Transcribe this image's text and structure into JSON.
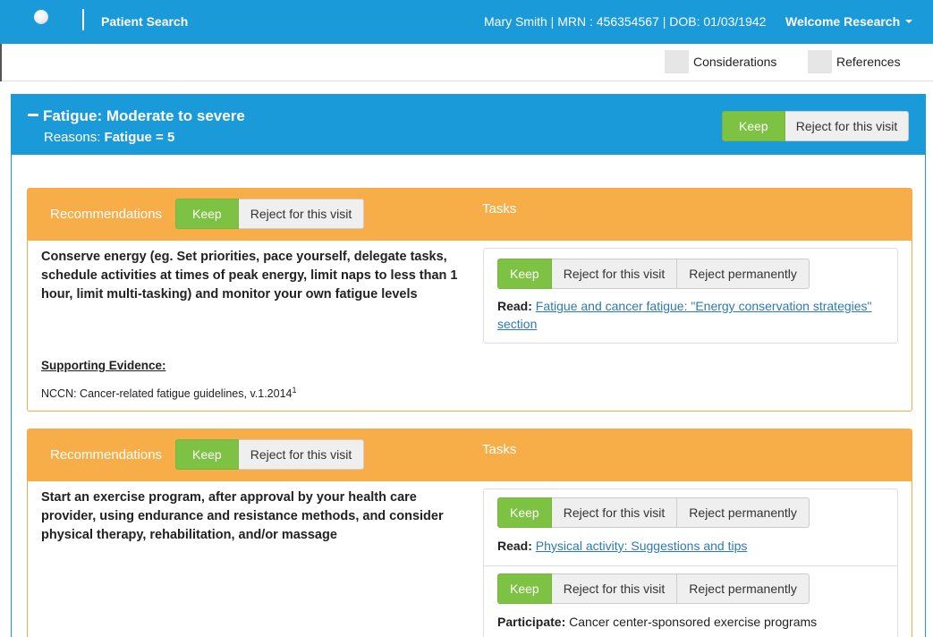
{
  "header": {
    "logo_icon": "logo-icon",
    "nav_title": "Patient Search",
    "patient_info": "Mary Smith | MRN : 456354567 | DOB: 01/03/1942",
    "user_menu": "Welcome Research",
    "user_menu_icon": "caret-down-icon",
    "brand_color": "#1a9ad9"
  },
  "subnav": {
    "considerations": "Considerations",
    "references": "References"
  },
  "panel": {
    "title": "Fatigue: Moderate to severe",
    "reasons_label": "Reasons:",
    "reasons_value": "Fatigue = 5",
    "keep": "Keep",
    "reject_visit": "Reject for this visit"
  },
  "cards": [
    {
      "recommendations_label": "Recommendations",
      "keep": "Keep",
      "reject_visit": "Reject for this visit",
      "tasks_label": "Tasks",
      "recommendation": "Conserve energy (eg. Set priorities, pace yourself, delegate tasks, schedule activities at times of peak energy, limit naps to less than 1 hour, limit multi-tasking) and monitor your own fatigue levels",
      "evidence_title": "Supporting Evidence:",
      "evidence_text": "NCCN: Cancer-related fatigue guidelines, v.1.2014",
      "evidence_sup": "1",
      "tasks": [
        {
          "keep": "Keep",
          "reject_visit": "Reject for this visit",
          "reject_perm": "Reject permanently",
          "action": "Read:",
          "link": "Fatigue and cancer fatigue: \"Energy conservation strategies\" section"
        }
      ]
    },
    {
      "recommendations_label": "Recommendations",
      "keep": "Keep",
      "reject_visit": "Reject for this visit",
      "tasks_label": "Tasks",
      "recommendation": "Start an exercise program, after approval by your health care provider, using endurance and resistance methods, and consider physical therapy, rehabilitation, and/or massage",
      "tasks": [
        {
          "keep": "Keep",
          "reject_visit": "Reject for this visit",
          "reject_perm": "Reject permanently",
          "action": "Read:",
          "link": "Physical activity: Suggestions and tips"
        },
        {
          "keep": "Keep",
          "reject_visit": "Reject for this visit",
          "reject_perm": "Reject permanently",
          "action": "Participate:",
          "text": "Cancer center-sponsored exercise programs"
        }
      ]
    }
  ],
  "colors": {
    "keep_green": "#7dc243",
    "card_orange": "#f8ae48",
    "link_blue": "#2a7ab8"
  }
}
